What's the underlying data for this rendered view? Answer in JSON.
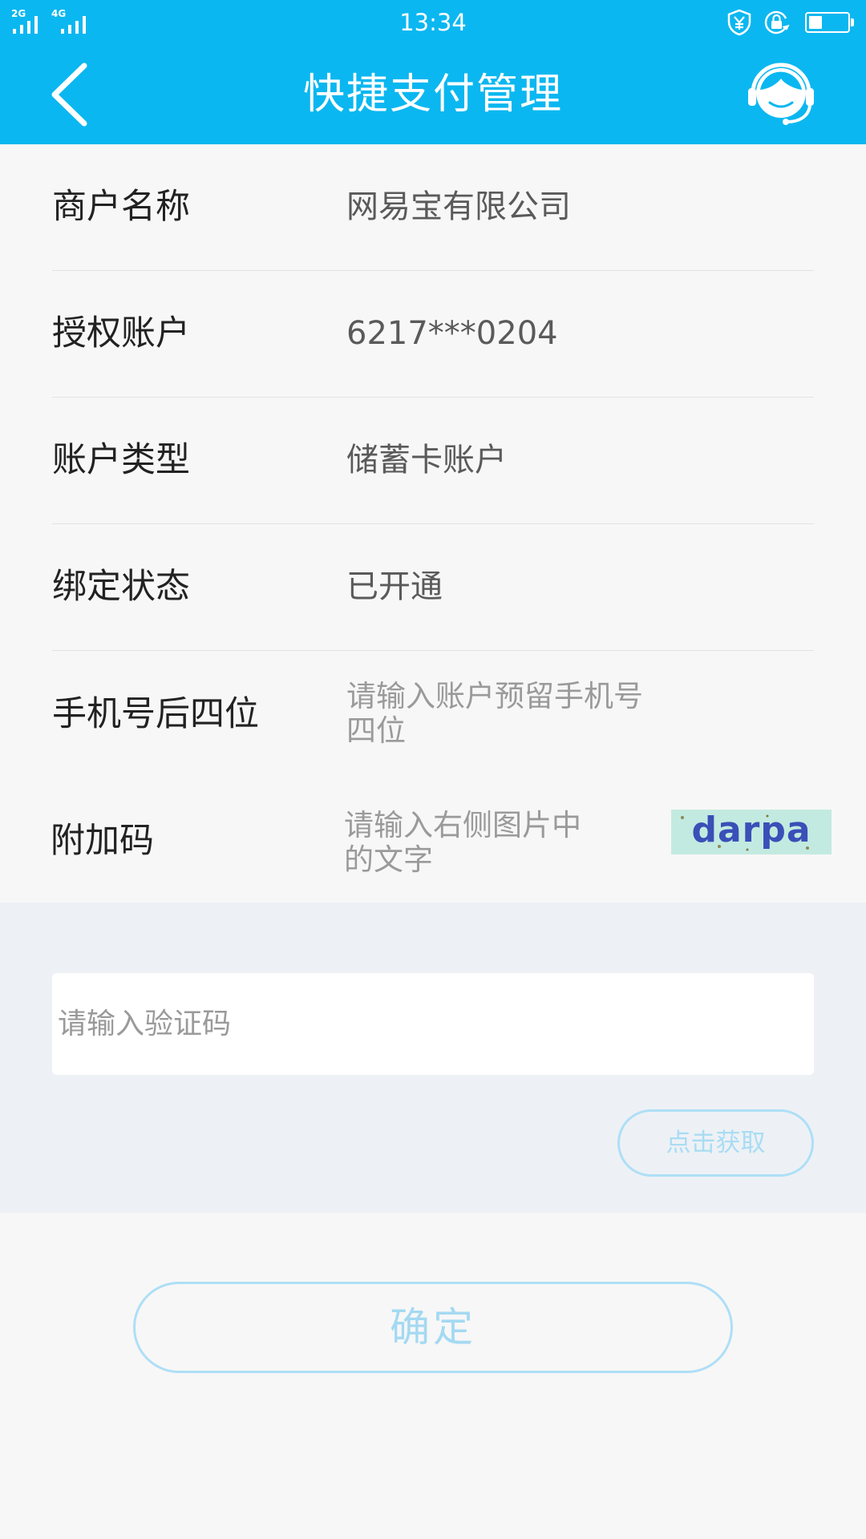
{
  "status_bar": {
    "network_1": "2G",
    "network_2": "4G",
    "time": "13:34",
    "battery_level": 0.35,
    "icons": [
      "yuan-shield-icon",
      "lock-sync-icon",
      "battery-icon"
    ]
  },
  "header": {
    "title": "快捷支付管理",
    "back_icon": "chevron-left-icon",
    "support_icon": "customer-service-icon"
  },
  "info": {
    "rows": [
      {
        "label": "商户名称",
        "value": "网易宝有限公司"
      },
      {
        "label": "授权账户",
        "value": "6217***0204"
      },
      {
        "label": "账户类型",
        "value": "储蓄卡账户"
      },
      {
        "label": "绑定状态",
        "value": "已开通"
      }
    ]
  },
  "phone_last4": {
    "label": "手机号后四位",
    "placeholder": "请输入账户预留手机号四位"
  },
  "captcha": {
    "label": "附加码",
    "placeholder": "请输入右侧图片中的文字",
    "image_text": "darpa"
  },
  "verify": {
    "placeholder": "请输入验证码",
    "get_code_label": "点击获取"
  },
  "confirm_label": "确定",
  "colors": {
    "brand": "#0bb7f0",
    "disabled_button": "#aedff6",
    "section_bg": "#edf1f5"
  }
}
